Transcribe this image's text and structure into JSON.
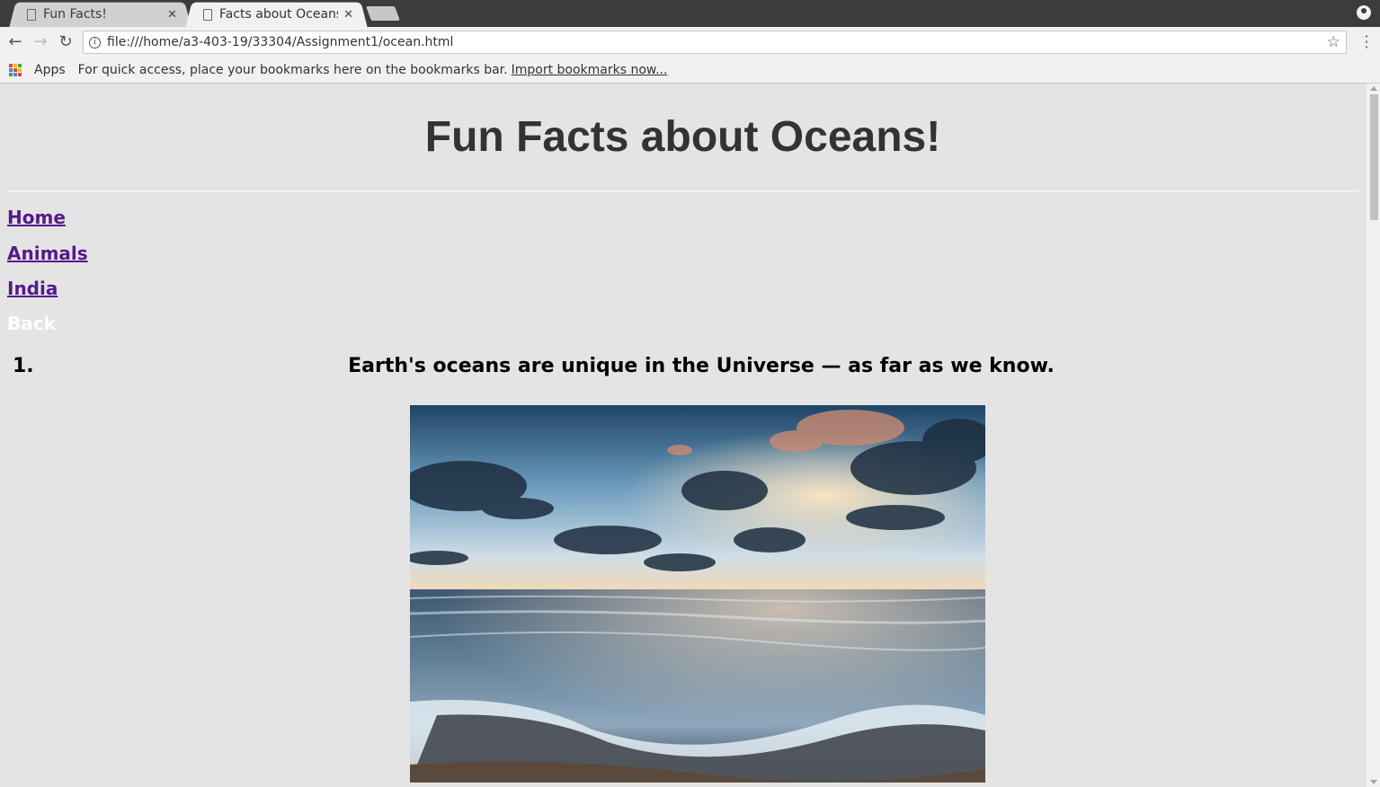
{
  "browser": {
    "tabs": [
      {
        "label": "Fun Facts!",
        "active": false
      },
      {
        "label": "Facts about Oceans",
        "active": true
      }
    ],
    "address_bar": {
      "url": "file:///home/a3-403-19/33304/Assignment1/ocean.html"
    },
    "bookmarks_bar": {
      "apps_label": "Apps",
      "message": "For quick access, place your bookmarks here on the bookmarks bar.",
      "import_link": "Import bookmarks now..."
    }
  },
  "page": {
    "title": "Fun Facts about Oceans!",
    "nav": [
      {
        "label": "Home"
      },
      {
        "label": "Animals"
      },
      {
        "label": "India"
      },
      {
        "label": "Back"
      }
    ],
    "facts": [
      {
        "number": "1.",
        "text": "Earth's oceans are unique in the Universe — as far as we know."
      }
    ]
  },
  "colors": {
    "page_background": "#e4e4e4",
    "visited_link": "#551a8b",
    "title_text": "#333333"
  }
}
